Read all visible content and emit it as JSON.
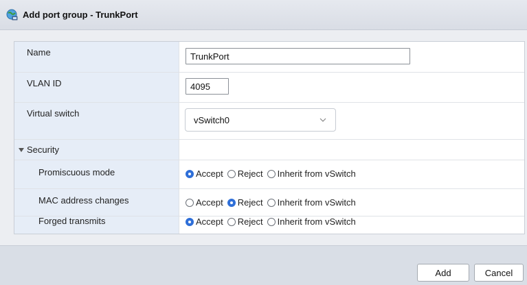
{
  "dialog": {
    "title": "Add port group - TrunkPort",
    "icon": "network-globe-icon"
  },
  "form": {
    "name": {
      "label": "Name",
      "value": "TrunkPort"
    },
    "vlan_id": {
      "label": "VLAN ID",
      "value": "4095"
    },
    "virtual_switch": {
      "label": "Virtual switch",
      "selected": "vSwitch0"
    },
    "security": {
      "label": "Security",
      "expanded": true,
      "options": [
        "Accept",
        "Reject",
        "Inherit from vSwitch"
      ],
      "promiscuous_mode": {
        "label": "Promiscuous mode",
        "selected": "Accept"
      },
      "mac_address_changes": {
        "label": "MAC address changes",
        "selected": "Reject"
      },
      "forged_transmits": {
        "label": "Forged transmits",
        "selected": "Accept"
      }
    }
  },
  "footer": {
    "add_label": "Add",
    "cancel_label": "Cancel"
  },
  "colors": {
    "accent": "#2f6fd8",
    "label_bg": "#e6edf7"
  }
}
